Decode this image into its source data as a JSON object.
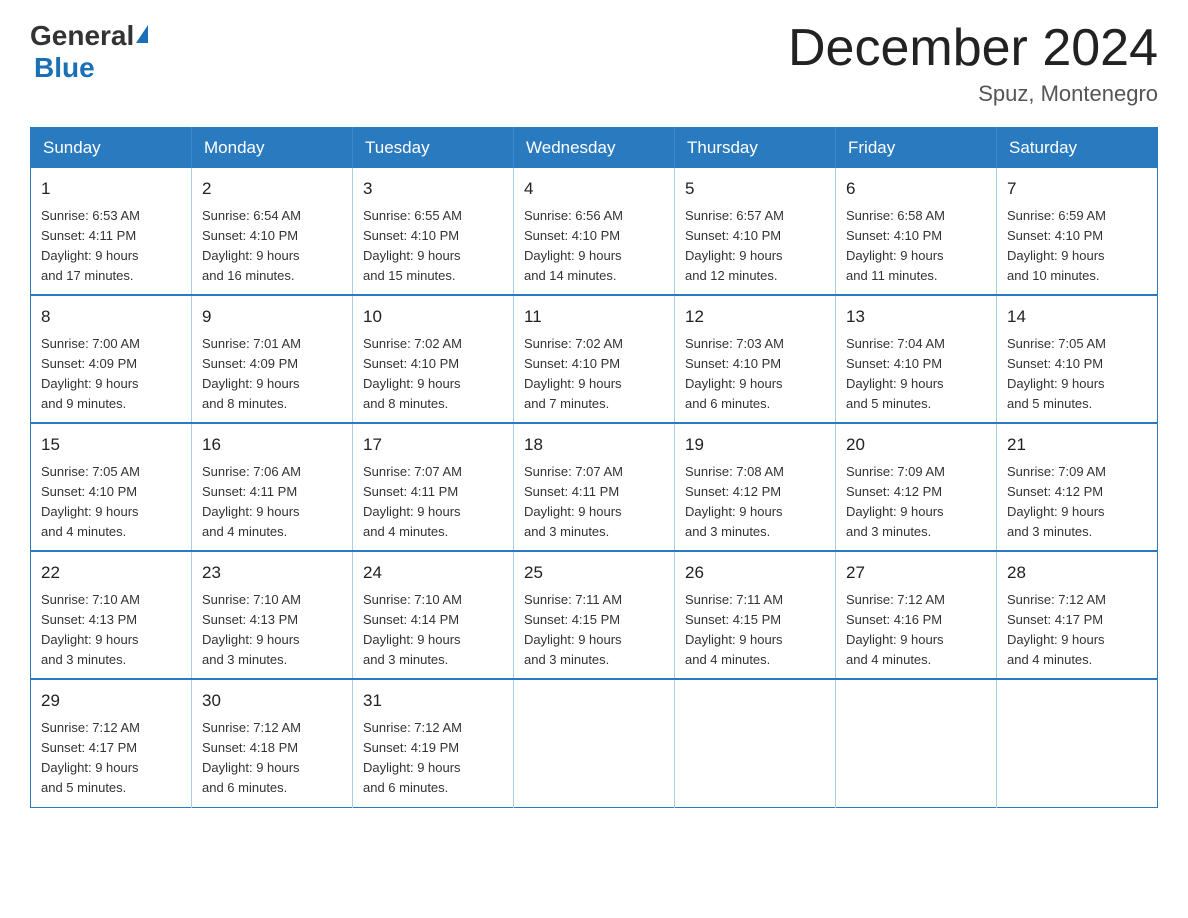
{
  "header": {
    "logo_general": "General",
    "logo_blue": "Blue",
    "month_title": "December 2024",
    "location": "Spuz, Montenegro"
  },
  "days_of_week": [
    "Sunday",
    "Monday",
    "Tuesday",
    "Wednesday",
    "Thursday",
    "Friday",
    "Saturday"
  ],
  "weeks": [
    [
      {
        "day": "1",
        "sunrise": "6:53 AM",
        "sunset": "4:11 PM",
        "daylight": "9 hours and 17 minutes."
      },
      {
        "day": "2",
        "sunrise": "6:54 AM",
        "sunset": "4:10 PM",
        "daylight": "9 hours and 16 minutes."
      },
      {
        "day": "3",
        "sunrise": "6:55 AM",
        "sunset": "4:10 PM",
        "daylight": "9 hours and 15 minutes."
      },
      {
        "day": "4",
        "sunrise": "6:56 AM",
        "sunset": "4:10 PM",
        "daylight": "9 hours and 14 minutes."
      },
      {
        "day": "5",
        "sunrise": "6:57 AM",
        "sunset": "4:10 PM",
        "daylight": "9 hours and 12 minutes."
      },
      {
        "day": "6",
        "sunrise": "6:58 AM",
        "sunset": "4:10 PM",
        "daylight": "9 hours and 11 minutes."
      },
      {
        "day": "7",
        "sunrise": "6:59 AM",
        "sunset": "4:10 PM",
        "daylight": "9 hours and 10 minutes."
      }
    ],
    [
      {
        "day": "8",
        "sunrise": "7:00 AM",
        "sunset": "4:09 PM",
        "daylight": "9 hours and 9 minutes."
      },
      {
        "day": "9",
        "sunrise": "7:01 AM",
        "sunset": "4:09 PM",
        "daylight": "9 hours and 8 minutes."
      },
      {
        "day": "10",
        "sunrise": "7:02 AM",
        "sunset": "4:10 PM",
        "daylight": "9 hours and 8 minutes."
      },
      {
        "day": "11",
        "sunrise": "7:02 AM",
        "sunset": "4:10 PM",
        "daylight": "9 hours and 7 minutes."
      },
      {
        "day": "12",
        "sunrise": "7:03 AM",
        "sunset": "4:10 PM",
        "daylight": "9 hours and 6 minutes."
      },
      {
        "day": "13",
        "sunrise": "7:04 AM",
        "sunset": "4:10 PM",
        "daylight": "9 hours and 5 minutes."
      },
      {
        "day": "14",
        "sunrise": "7:05 AM",
        "sunset": "4:10 PM",
        "daylight": "9 hours and 5 minutes."
      }
    ],
    [
      {
        "day": "15",
        "sunrise": "7:05 AM",
        "sunset": "4:10 PM",
        "daylight": "9 hours and 4 minutes."
      },
      {
        "day": "16",
        "sunrise": "7:06 AM",
        "sunset": "4:11 PM",
        "daylight": "9 hours and 4 minutes."
      },
      {
        "day": "17",
        "sunrise": "7:07 AM",
        "sunset": "4:11 PM",
        "daylight": "9 hours and 4 minutes."
      },
      {
        "day": "18",
        "sunrise": "7:07 AM",
        "sunset": "4:11 PM",
        "daylight": "9 hours and 3 minutes."
      },
      {
        "day": "19",
        "sunrise": "7:08 AM",
        "sunset": "4:12 PM",
        "daylight": "9 hours and 3 minutes."
      },
      {
        "day": "20",
        "sunrise": "7:09 AM",
        "sunset": "4:12 PM",
        "daylight": "9 hours and 3 minutes."
      },
      {
        "day": "21",
        "sunrise": "7:09 AM",
        "sunset": "4:12 PM",
        "daylight": "9 hours and 3 minutes."
      }
    ],
    [
      {
        "day": "22",
        "sunrise": "7:10 AM",
        "sunset": "4:13 PM",
        "daylight": "9 hours and 3 minutes."
      },
      {
        "day": "23",
        "sunrise": "7:10 AM",
        "sunset": "4:13 PM",
        "daylight": "9 hours and 3 minutes."
      },
      {
        "day": "24",
        "sunrise": "7:10 AM",
        "sunset": "4:14 PM",
        "daylight": "9 hours and 3 minutes."
      },
      {
        "day": "25",
        "sunrise": "7:11 AM",
        "sunset": "4:15 PM",
        "daylight": "9 hours and 3 minutes."
      },
      {
        "day": "26",
        "sunrise": "7:11 AM",
        "sunset": "4:15 PM",
        "daylight": "9 hours and 4 minutes."
      },
      {
        "day": "27",
        "sunrise": "7:12 AM",
        "sunset": "4:16 PM",
        "daylight": "9 hours and 4 minutes."
      },
      {
        "day": "28",
        "sunrise": "7:12 AM",
        "sunset": "4:17 PM",
        "daylight": "9 hours and 4 minutes."
      }
    ],
    [
      {
        "day": "29",
        "sunrise": "7:12 AM",
        "sunset": "4:17 PM",
        "daylight": "9 hours and 5 minutes."
      },
      {
        "day": "30",
        "sunrise": "7:12 AM",
        "sunset": "4:18 PM",
        "daylight": "9 hours and 6 minutes."
      },
      {
        "day": "31",
        "sunrise": "7:12 AM",
        "sunset": "4:19 PM",
        "daylight": "9 hours and 6 minutes."
      },
      null,
      null,
      null,
      null
    ]
  ]
}
